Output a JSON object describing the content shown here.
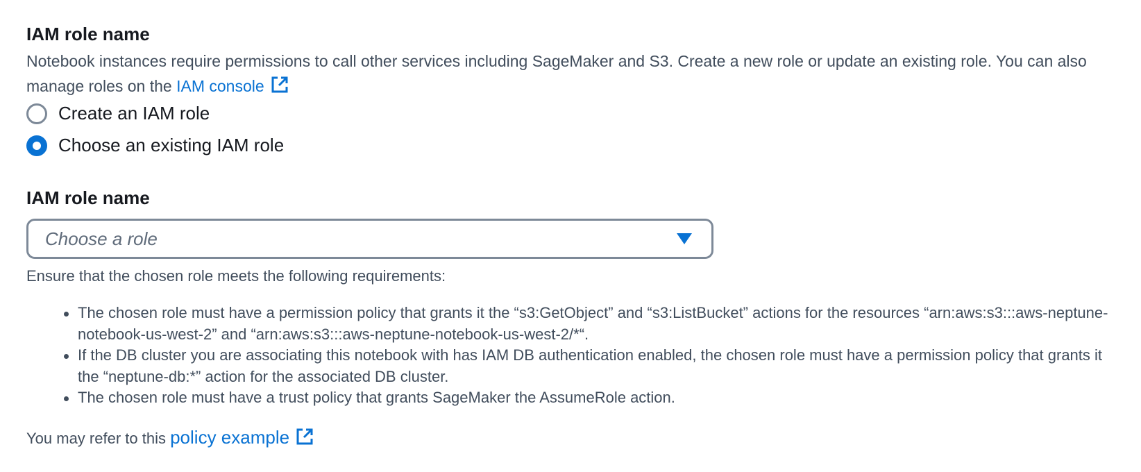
{
  "role_section": {
    "title": "IAM role name",
    "description": "Notebook instances require permissions to call other services including SageMaker and S3. Create a new role or update an existing role. You can also manage roles on the",
    "console_link": "IAM console",
    "options": [
      {
        "label": "Create an IAM role",
        "checked": false
      },
      {
        "label": "Choose an existing IAM role",
        "checked": true
      }
    ]
  },
  "role_select": {
    "title": "IAM role name",
    "placeholder": "Choose a role"
  },
  "requirements": {
    "intro": "Ensure that the chosen role meets the following requirements:",
    "items": [
      "The chosen role must have a permission policy that grants it the “s3:GetObject” and “s3:ListBucket” actions for the resources “arn:aws:s3:::aws-neptune-notebook-us-west-2” and “arn:aws:s3:::aws-neptune-notebook-us-west-2/*“.",
      "If the DB cluster you are associating this notebook with has IAM DB authentication enabled, the chosen role must have a permission policy that grants it the “neptune-db:*” action for the associated DB cluster.",
      "The chosen role must have a trust policy that grants SageMaker the AssumeRole action."
    ]
  },
  "refer": {
    "text": "You may refer to this",
    "link": "policy example"
  },
  "colors": {
    "accent": "#0972d3",
    "text": "#16191f",
    "secondary_text": "#414d5c",
    "border": "#7d8998"
  },
  "icons": {
    "external_link": "external-link-icon",
    "dropdown": "caret-down-icon"
  }
}
